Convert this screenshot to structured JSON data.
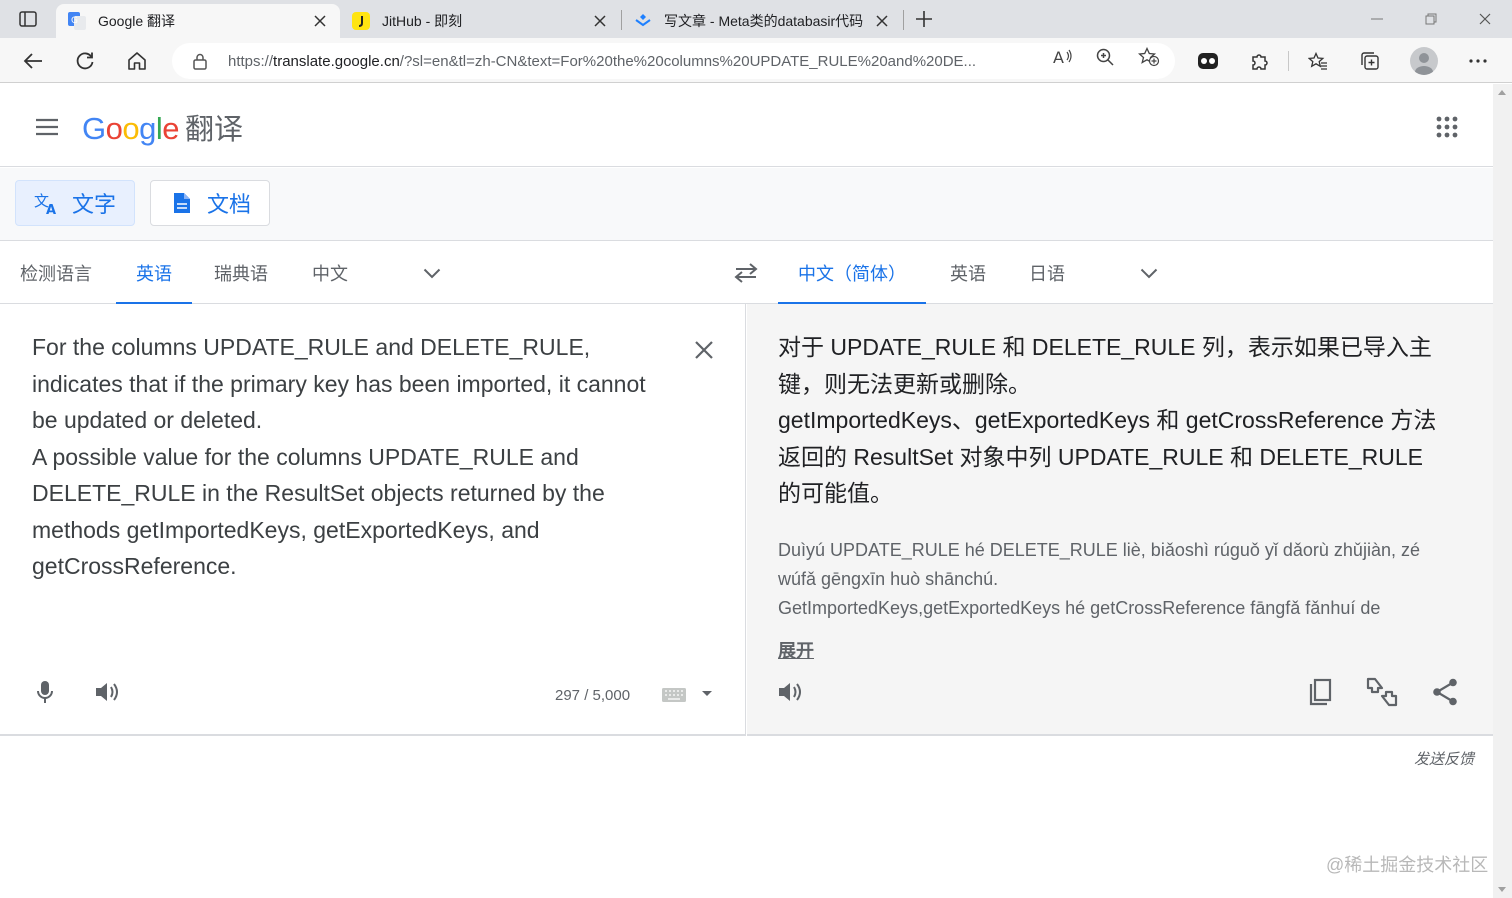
{
  "browser": {
    "tabs": [
      {
        "title": "Google 翻译",
        "active": true,
        "favicon": "google-translate-icon"
      },
      {
        "title": "JitHub - 即刻",
        "active": false,
        "favicon": "jike-icon"
      },
      {
        "title": "写文章 - Meta类的databasir代码",
        "active": false,
        "favicon": "juejin-icon"
      }
    ],
    "url_prefix": "https://",
    "url_host": "translate.google.cn",
    "url_rest": "/?sl=en&tl=zh-CN&text=For%20the%20columns%20UPDATE_RULE%20and%20DE..."
  },
  "app": {
    "logo_text": "Google",
    "product_name": "翻译",
    "modes": {
      "text": "文字",
      "document": "文档"
    },
    "source_langs": [
      "检测语言",
      "英语",
      "瑞典语",
      "中文"
    ],
    "target_langs": [
      "中文（简体）",
      "英语",
      "日语"
    ],
    "source_text": "For the columns UPDATE_RULE and DELETE_RULE, indicates that if the primary key has been imported, it cannot be updated or deleted.\nA possible value for the columns UPDATE_RULE and DELETE_RULE in the ResultSet objects returned by the methods getImportedKeys, getExportedKeys, and getCrossReference.",
    "char_count": "297 / 5,000",
    "target_text": "对于 UPDATE_RULE 和 DELETE_RULE 列，表示如果已导入主键，则无法更新或删除。\ngetImportedKeys、getExportedKeys 和 getCrossReference 方法返回的 ResultSet 对象中列 UPDATE_RULE 和 DELETE_RULE 的可能值。",
    "romanization": "Duìyú UPDATE_RULE hé DELETE_RULE liè, biǎoshì rúguǒ yǐ dǎorù zhǔjiàn, zé wúfǎ gēngxīn huò shānchú.\nGetImportedKeys,getExportedKeys hé getCrossReference fāngfǎ fǎnhuí de",
    "expand_label": "展开",
    "feedback_label": "发送反馈"
  },
  "watermark": "@稀土掘金技术社区",
  "colors": {
    "accent": "#1a73e8",
    "tabbar": "#dfe1e5",
    "target_bg": "#f5f5f5"
  }
}
